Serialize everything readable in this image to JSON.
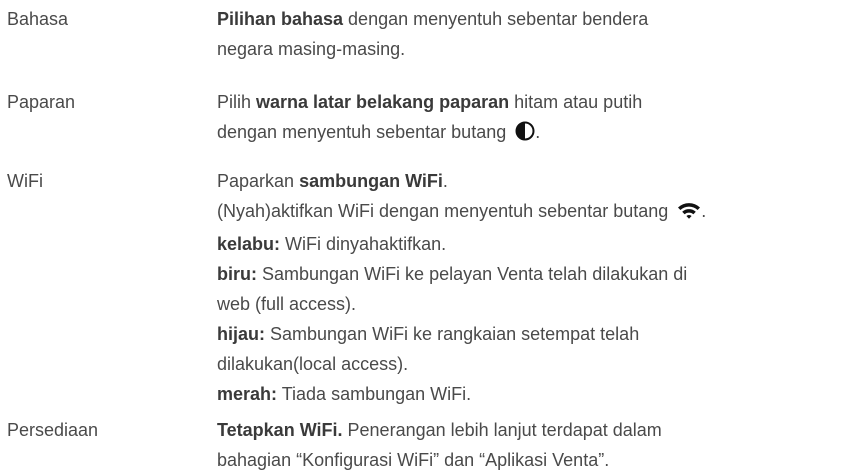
{
  "rows": [
    {
      "term": "Bahasa",
      "lines": [
        [
          {
            "t": "Pilihan bahasa",
            "b": true
          },
          {
            "t": " dengan menyentuh sebentar bendera"
          }
        ],
        [
          {
            "t": "negara masing-masing."
          }
        ]
      ]
    },
    {
      "term": "Paparan",
      "lines": [
        [
          {
            "t": "Pilih "
          },
          {
            "t": "warna latar belakang paparan",
            "b": true
          },
          {
            "t": " hitam atau putih"
          }
        ],
        [
          {
            "t": "dengan menyentuh sebentar butang "
          },
          {
            "icon": "contrast-icon"
          },
          {
            "t": "."
          }
        ]
      ]
    },
    {
      "term": "WiFi",
      "lines": [
        [
          {
            "t": "Paparkan "
          },
          {
            "t": "sambungan WiFi",
            "b": true
          },
          {
            "t": "."
          }
        ],
        [
          {
            "t": "(Nyah)aktifkan WiFi dengan menyentuh sebentar butang "
          },
          {
            "icon": "wifi-icon"
          },
          {
            "t": "."
          }
        ],
        [
          {
            "t": "kelabu:",
            "b": true
          },
          {
            "t": " WiFi dinyahaktifkan."
          }
        ],
        [
          {
            "t": "biru:",
            "b": true
          },
          {
            "t": " Sambungan WiFi ke pelayan Venta telah dilakukan di"
          }
        ],
        [
          {
            "t": "web (full access)."
          }
        ],
        [
          {
            "t": "hijau:",
            "b": true
          },
          {
            "t": " Sambungan WiFi ke rangkaian setempat telah"
          }
        ],
        [
          {
            "t": "dilakukan(local access)."
          }
        ],
        [
          {
            "t": "merah:",
            "b": true
          },
          {
            "t": " Tiada sambungan WiFi."
          }
        ]
      ]
    },
    {
      "term": "Persediaan",
      "lines": [
        [
          {
            "t": "Tetapkan WiFi.",
            "b": true
          },
          {
            "t": " Penerangan lebih lanjut terdapat dalam"
          }
        ],
        [
          {
            "t": "bahagian “Konfigurasi WiFi” dan “Aplikasi Venta”."
          }
        ]
      ]
    }
  ]
}
